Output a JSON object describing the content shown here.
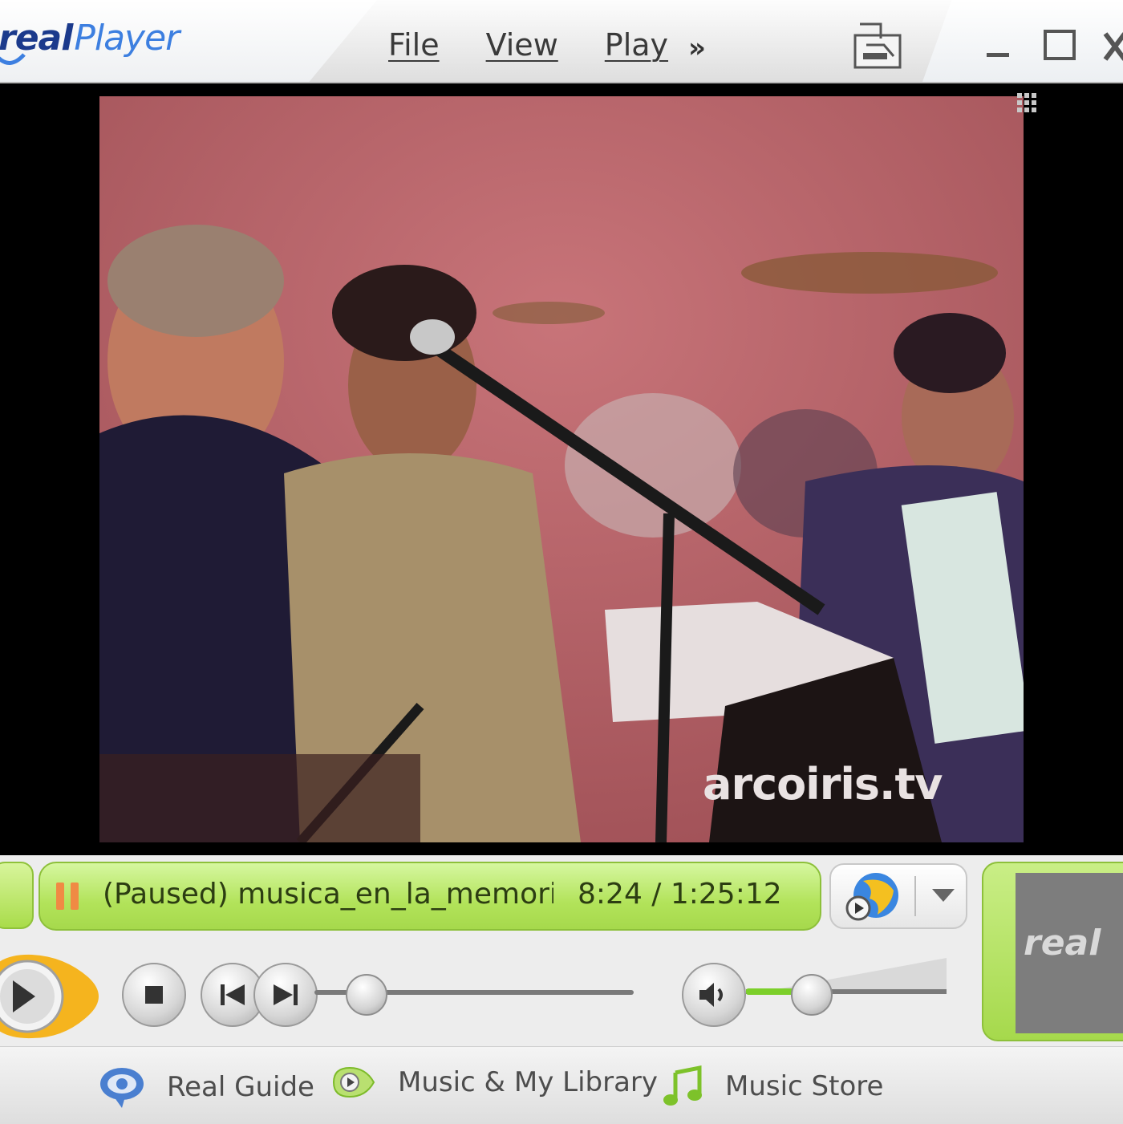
{
  "app": {
    "logo_real": "real",
    "logo_player": "Player"
  },
  "menu": {
    "items": [
      {
        "label": "File"
      },
      {
        "label": "View"
      },
      {
        "label": "Play"
      }
    ],
    "more_label": "»"
  },
  "video": {
    "watermark": "arcoiris.tv"
  },
  "status": {
    "state_and_title": "(Paused) musica_en_la_memoria",
    "time": "8:24 / 1:25:12",
    "playback_position": 0.099
  },
  "volume": {
    "level": 0.2
  },
  "mini_logo": "real",
  "guide": {
    "items": [
      {
        "label": "Real Guide"
      },
      {
        "label": "Music & My Library"
      },
      {
        "label": "Music Store"
      }
    ]
  },
  "colors": {
    "status_green": "#b2e35a",
    "play_orange": "#f5b41e",
    "logo_blue": "#1b3a8c",
    "video_bg": "#b9656a"
  }
}
